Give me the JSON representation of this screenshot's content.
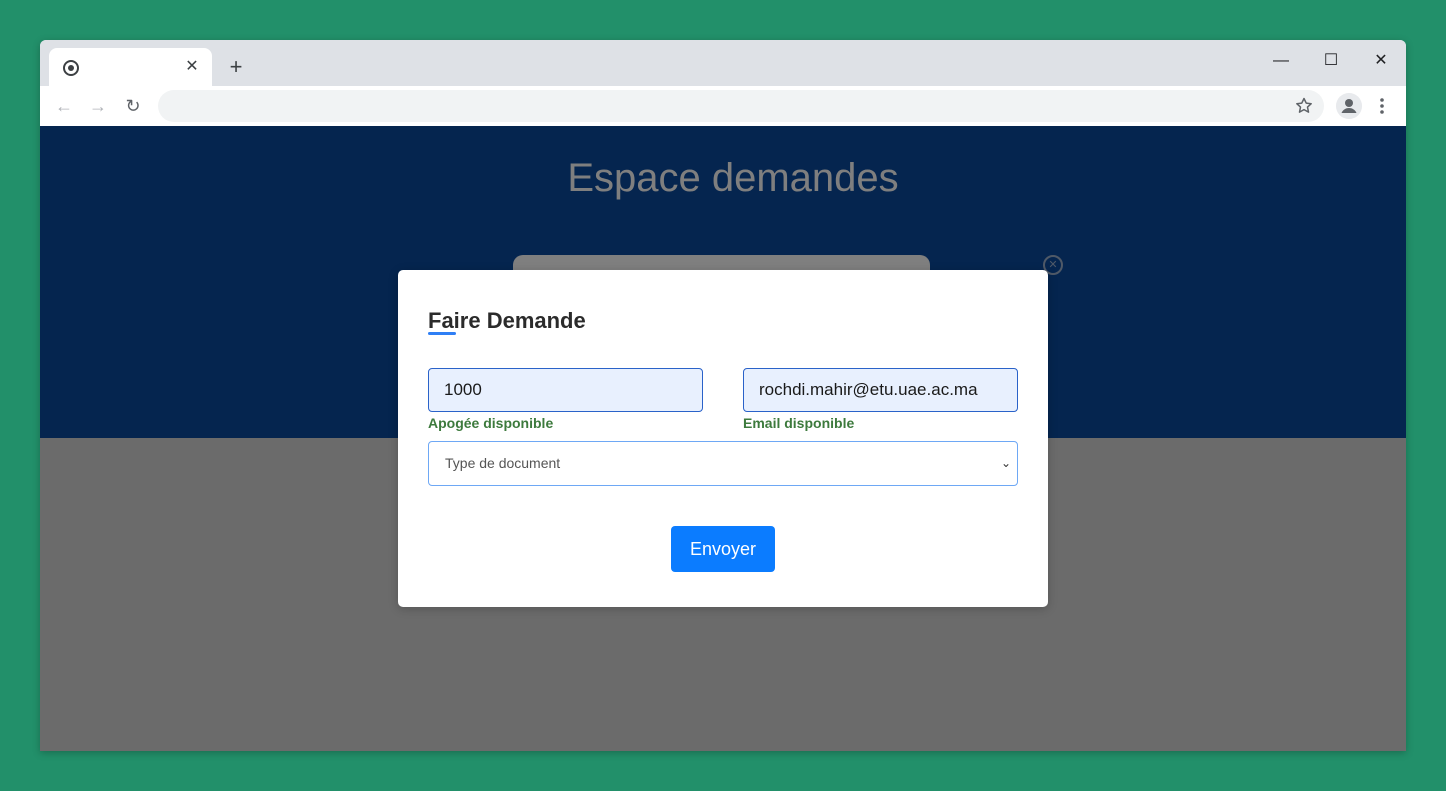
{
  "browser": {
    "tab": {
      "title": "",
      "close_glyph": "✕"
    },
    "new_tab_glyph": "+",
    "window_controls": {
      "minimize": "—",
      "maximize": "☐",
      "close": "✕"
    },
    "nav": {
      "back": "←",
      "forward": "→",
      "reload": "↻"
    },
    "address": {
      "url": ""
    }
  },
  "page": {
    "title": "Espace demandes"
  },
  "modal": {
    "title": "Faire Demande",
    "apogee": {
      "value": "1000",
      "message": "Apogée disponible"
    },
    "email": {
      "value": "rochdi.mahir@etu.uae.ac.ma",
      "message": "Email disponible"
    },
    "document_type": {
      "selected": "Type de document"
    },
    "submit_label": "Envoyer"
  },
  "colors": {
    "desktop": "#22906a",
    "hero": "#0a4a9e",
    "valid": "#3d7a3d",
    "accent": "#0b7cff"
  }
}
